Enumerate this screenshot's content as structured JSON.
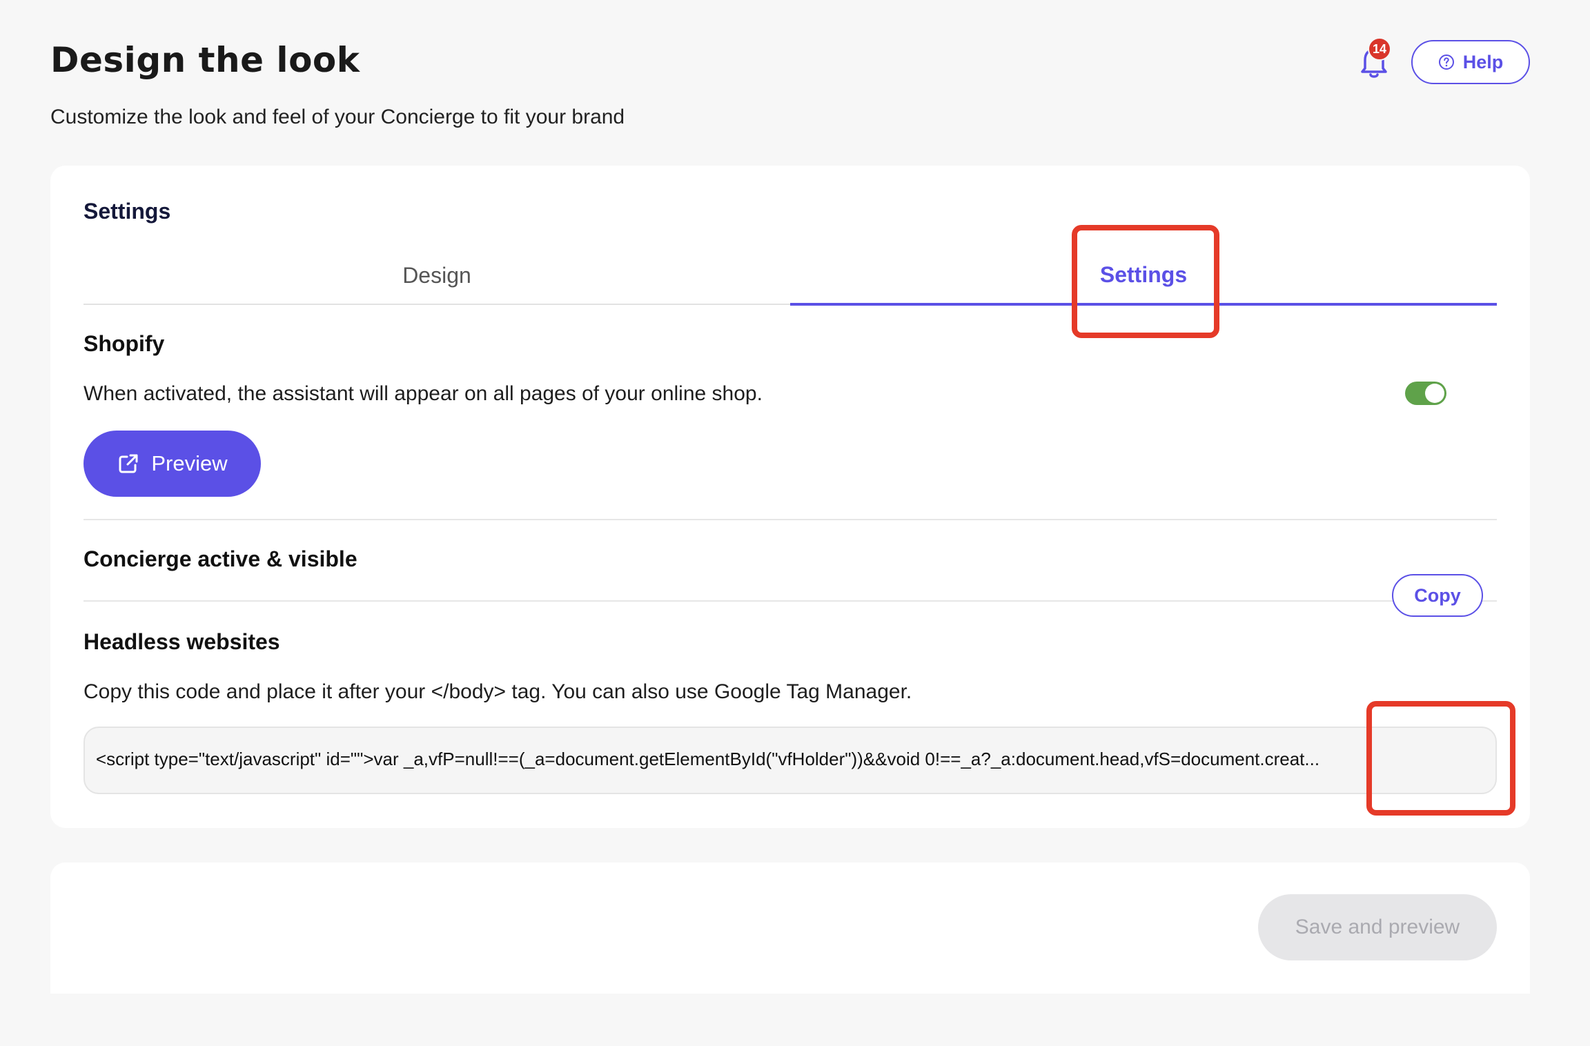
{
  "header": {
    "title": "Design the look",
    "subtitle": "Customize the look and feel of your Concierge to fit your brand",
    "notifications_count": "14",
    "help_label": "Help"
  },
  "card": {
    "title": "Settings",
    "tabs": [
      {
        "label": "Design",
        "active": false
      },
      {
        "label": "Settings",
        "active": true
      }
    ]
  },
  "shopify": {
    "heading": "Shopify",
    "description": "When activated, the assistant will appear on all pages of your online shop.",
    "preview_label": "Preview"
  },
  "concierge": {
    "label": "Concierge active & visible",
    "toggle_on": true
  },
  "headless": {
    "heading": "Headless websites",
    "description": "Copy this code and place it after your </body> tag. You can also use Google Tag Manager.",
    "code": "<script type=\"text/javascript\" id=\"\">var _a,vfP=null!==(_a=document.getElementById(\"vfHolder\"))&&void 0!==_a?_a:document.head,vfS=document.creat...",
    "copy_label": "Copy"
  },
  "footer": {
    "save_label": "Save and preview"
  },
  "colors": {
    "accent": "#5b50e6",
    "toggle_on": "#5fa24a",
    "highlight": "#e53a28",
    "badge": "#d9352a"
  }
}
